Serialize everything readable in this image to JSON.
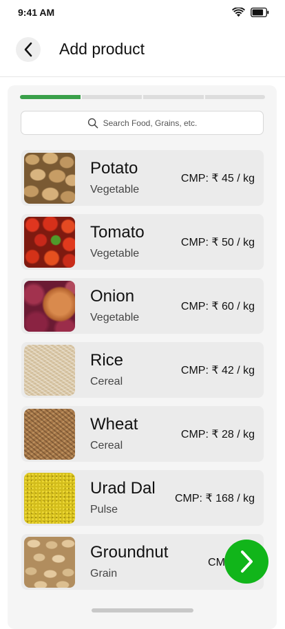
{
  "status_bar": {
    "time": "9:41 AM",
    "wifi_icon": "wifi-icon",
    "battery_icon": "battery-icon"
  },
  "header": {
    "back_icon": "chevron-left-icon",
    "title": "Add product"
  },
  "progress": {
    "total_steps": 4,
    "current_step": 1,
    "active_color": "#3aa04a",
    "inactive_color": "#dddddd"
  },
  "search": {
    "icon": "search-icon",
    "placeholder": "Search Food, Grains, etc."
  },
  "products": [
    {
      "name": "Potato",
      "category": "Vegetable",
      "price": "CMP: ₹ 45 / kg",
      "image": "potato-image"
    },
    {
      "name": "Tomato",
      "category": "Vegetable",
      "price": "CMP: ₹ 50 / kg",
      "image": "tomato-image"
    },
    {
      "name": "Onion",
      "category": "Vegetable",
      "price": "CMP: ₹ 60 / kg",
      "image": "onion-image"
    },
    {
      "name": "Rice",
      "category": "Cereal",
      "price": "CMP: ₹ 42 / kg",
      "image": "rice-image"
    },
    {
      "name": "Wheat",
      "category": "Cereal",
      "price": "CMP: ₹ 28 / kg",
      "image": "wheat-image"
    },
    {
      "name": "Urad Dal",
      "category": "Pulse",
      "price": "CMP: ₹ 168 / kg",
      "image": "urad-dal-image"
    },
    {
      "name": "Groundnut",
      "category": "Grain",
      "price": "CMP: ₹ 5",
      "image": "groundnut-image"
    }
  ],
  "next_button": {
    "icon": "chevron-right-icon",
    "color": "#11b51a"
  }
}
